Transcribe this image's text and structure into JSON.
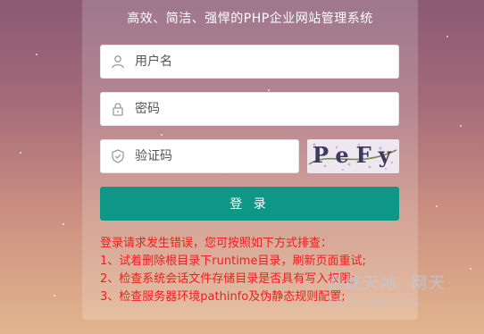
{
  "header": {
    "subtitle": "高效、简洁、强悍的PHP企业网站管理系统"
  },
  "form": {
    "username_placeholder": "用户名",
    "password_placeholder": "密码",
    "captcha_placeholder": "验证码",
    "captcha_text": "PeFy",
    "login_label": "登 录"
  },
  "error": {
    "title": "登录请求发生错误，您可按照如下方式排查：",
    "items": [
      "1、试着删除根目录下runtime目录，刷新页面重试;",
      "2、检查系统会话文件存储目录是否具有写入权限;",
      "3、检查服务器环境pathinfo及伪静态规则配置;"
    ]
  },
  "watermark": {
    "line1": "系统天地",
    "line1b": "网天",
    "line2": "最专业的系统资源下载站"
  },
  "colors": {
    "primary_button": "#0e9686",
    "error_text": "#f01e1e",
    "input_background": "#ffffff"
  },
  "icons": {
    "username": "user-icon",
    "password": "lock-icon",
    "captcha": "shield-icon"
  }
}
